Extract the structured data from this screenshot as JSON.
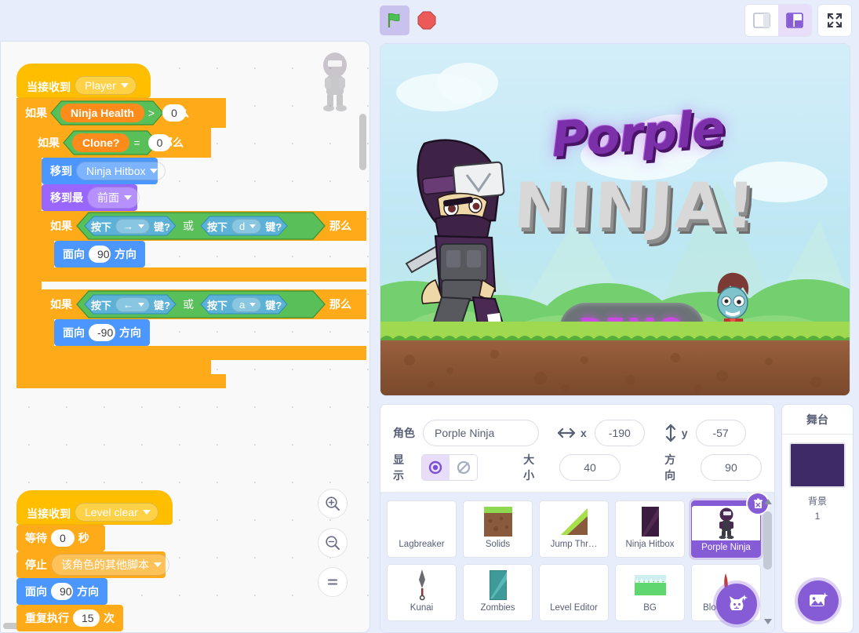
{
  "toolbar": {
    "green_flag": "green-flag",
    "stop": "stop-sign",
    "small_stage": "small-stage-layout",
    "large_stage": "large-stage-layout",
    "fullscreen": "fullscreen"
  },
  "code": {
    "scripts": [
      {
        "hat": {
          "label": "当接收到",
          "dropdown": "Player"
        },
        "blocks": [
          {
            "type": "if",
            "label_if": "如果",
            "label_then": "那么",
            "condition": {
              "op": ">",
              "left": "Ninja Health",
              "right": "0"
            }
          },
          {
            "type": "if",
            "label_if": "如果",
            "label_then": "那么",
            "condition": {
              "op": "=",
              "left": "Clone?",
              "right": "0"
            }
          },
          {
            "type": "motion",
            "label": "移到",
            "dropdown": "Ninja Hitbox"
          },
          {
            "type": "looks",
            "label": "移到最",
            "dropdown": "前面"
          },
          {
            "type": "if",
            "label_if": "如果",
            "label_then": "那么",
            "condition": {
              "op": "或",
              "left": {
                "pre": "按下",
                "key": "→",
                "post": "键?"
              },
              "right": {
                "pre": "按下",
                "key": "d",
                "post": "键?"
              }
            }
          },
          {
            "type": "point",
            "pre": "面向",
            "value": "90",
            "post": "方向"
          },
          {
            "type": "if",
            "label_if": "如果",
            "label_then": "那么",
            "condition": {
              "op": "或",
              "left": {
                "pre": "按下",
                "key": "←",
                "post": "键?"
              },
              "right": {
                "pre": "按下",
                "key": "a",
                "post": "键?"
              }
            }
          },
          {
            "type": "point",
            "pre": "面向",
            "value": "-90",
            "post": "方向"
          }
        ]
      },
      {
        "hat": {
          "label": "当接收到",
          "dropdown": "Level clear"
        },
        "blocks": [
          {
            "type": "wait",
            "pre": "等待",
            "value": "0",
            "post": "秒"
          },
          {
            "type": "stop",
            "pre": "停止",
            "dropdown": "该角色的其他脚本"
          },
          {
            "type": "point",
            "pre": "面向",
            "value": "90",
            "post": "方向"
          },
          {
            "type": "repeat",
            "pre": "重复执行",
            "value": "15",
            "post": "次"
          }
        ]
      }
    ],
    "zoom_in": "zoom-in",
    "zoom_out": "zoom-out",
    "zoom_reset": "zoom-reset"
  },
  "stage": {
    "title_line1": "Porple",
    "title_line2": "NINJA!",
    "demo_badge": "DEMO"
  },
  "sprite_info": {
    "name_label": "角色",
    "name_value": "Porple Ninja",
    "x_label": "x",
    "x_value": "-190",
    "y_label": "y",
    "y_value": "-57",
    "show_label": "显示",
    "size_label": "大小",
    "size_value": "40",
    "direction_label": "方向",
    "direction_value": "90"
  },
  "sprites": [
    {
      "name": "Lagbreaker",
      "selected": false,
      "icon": "blank"
    },
    {
      "name": "Solids",
      "selected": false,
      "icon": "solids"
    },
    {
      "name": "Jump Thr…",
      "selected": false,
      "icon": "jumpthrough"
    },
    {
      "name": "Ninja Hitbox",
      "selected": false,
      "icon": "hitbox"
    },
    {
      "name": "Porple Ninja",
      "selected": true,
      "icon": "ninja"
    },
    {
      "name": "Kunai",
      "selected": false,
      "icon": "kunai"
    },
    {
      "name": "Zombies",
      "selected": false,
      "icon": "zombies"
    },
    {
      "name": "Level Editor",
      "selected": false,
      "icon": "blank"
    },
    {
      "name": "BG",
      "selected": false,
      "icon": "bg"
    },
    {
      "name": "Blood spl…",
      "selected": false,
      "icon": "blood"
    }
  ],
  "stage_panel": {
    "title": "舞台",
    "backdrop_label": "背景",
    "backdrop_count": "1"
  },
  "colors": {
    "accent_purple": "#855cd6",
    "events_yellow": "#ffbf00",
    "control_orange": "#ffab19",
    "motion_blue": "#4c97ff",
    "looks_purple": "#9966ff",
    "operators_green": "#59c059",
    "sensing_blue": "#5cb1d6",
    "variables_orange": "#ff8c1a",
    "backdrop_fill": "#3e2a66"
  }
}
